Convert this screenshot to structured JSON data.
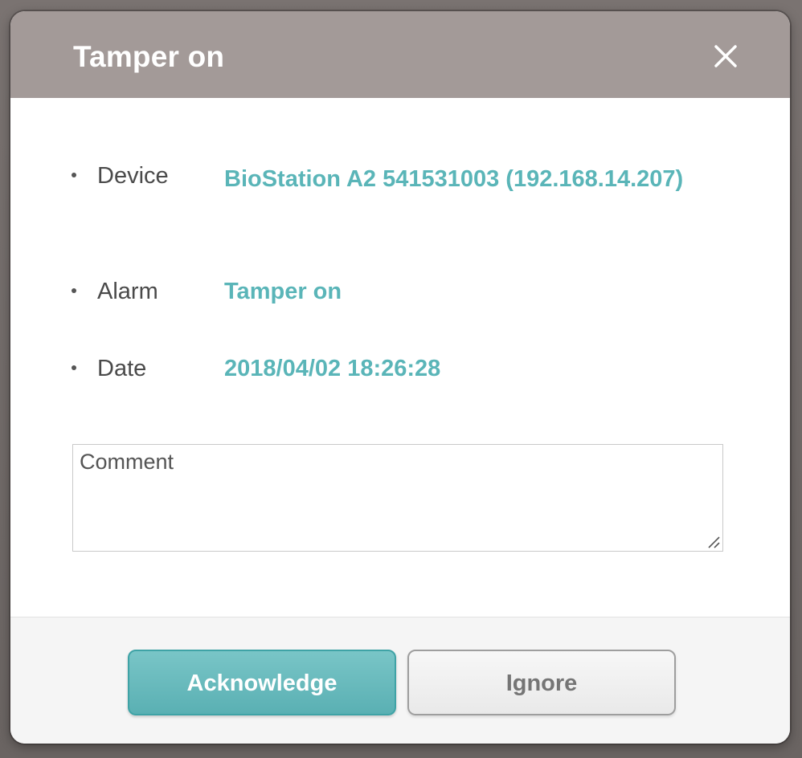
{
  "dialog": {
    "title": "Tamper on",
    "close_icon": "close-icon"
  },
  "details": [
    {
      "label": "Device",
      "value": "BioStation A2 541531003 (192.168.14.207)"
    },
    {
      "label": "Alarm",
      "value": "Tamper on"
    },
    {
      "label": "Date",
      "value": "2018/04/02 18:26:28"
    }
  ],
  "comment": {
    "placeholder": "Comment",
    "value": ""
  },
  "footer": {
    "acknowledge_label": "Acknowledge",
    "ignore_label": "Ignore"
  },
  "colors": {
    "header": "#a39a98",
    "accent": "#5ab5b8",
    "primary_button": "#5ab0b3",
    "backdrop": "#6e6866"
  }
}
